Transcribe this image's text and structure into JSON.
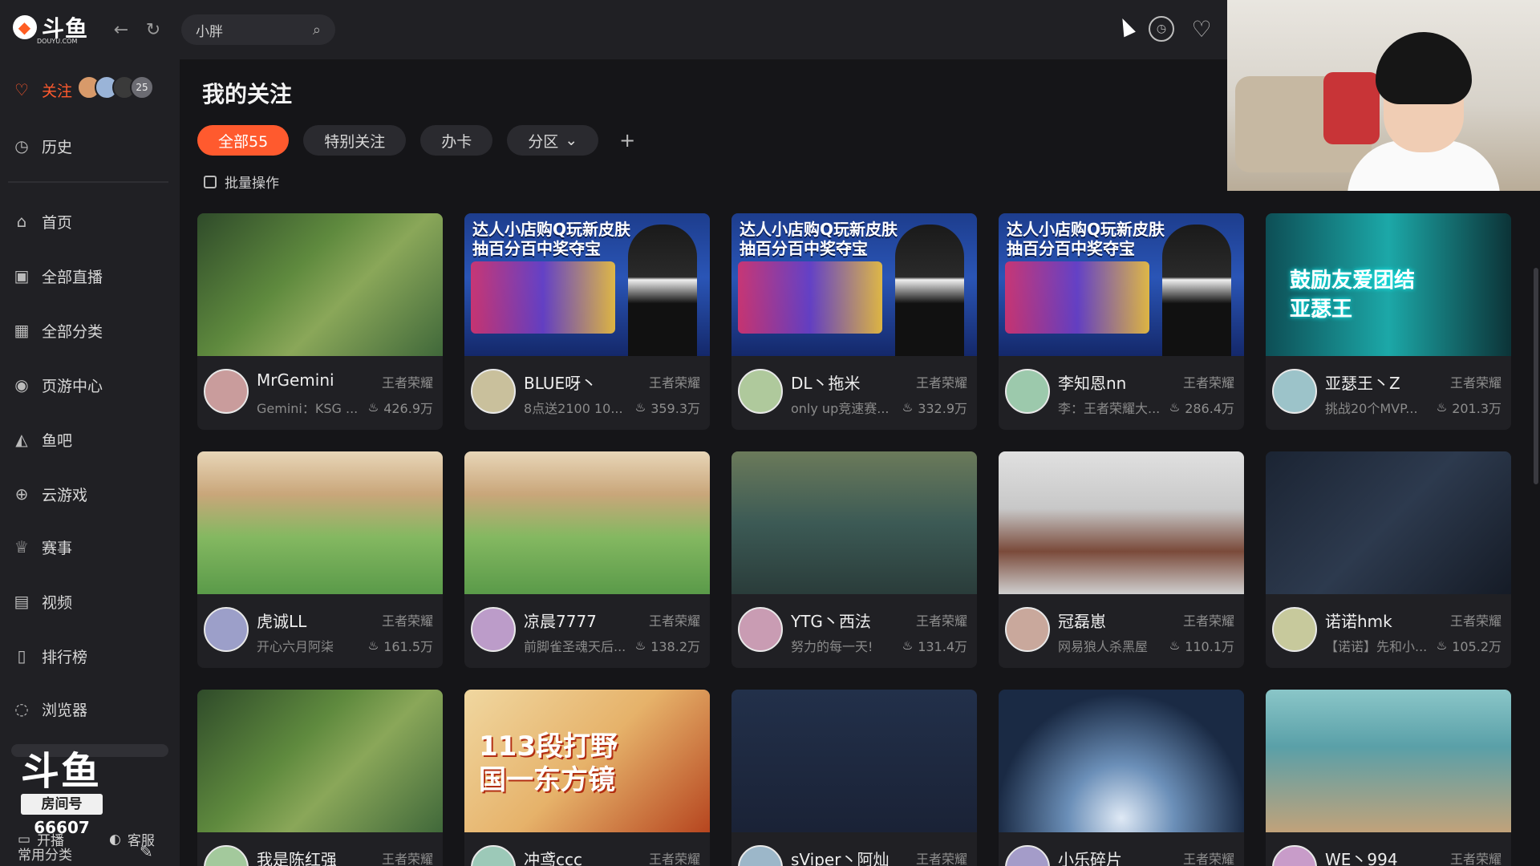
{
  "app": {
    "logo_text": "斗鱼",
    "logo_domain": "DOUYU.COM"
  },
  "search": {
    "value": "小胖"
  },
  "sidebar": {
    "follow": {
      "label": "关注",
      "count": "25"
    },
    "history": {
      "label": "历史"
    },
    "items": [
      {
        "label": "首页",
        "icon": "home-icon"
      },
      {
        "label": "全部直播",
        "icon": "live-icon"
      },
      {
        "label": "全部分类",
        "icon": "grid-icon"
      },
      {
        "label": "页游中心",
        "icon": "game-center-icon"
      },
      {
        "label": "鱼吧",
        "icon": "fishbar-icon"
      },
      {
        "label": "云游戏",
        "icon": "controller-icon"
      },
      {
        "label": "赛事",
        "icon": "trophy-icon"
      },
      {
        "label": "视频",
        "icon": "video-icon"
      },
      {
        "label": "排行榜",
        "icon": "rank-icon"
      },
      {
        "label": "浏览器",
        "icon": "browser-icon"
      }
    ],
    "common_label": "常用分类",
    "room_logo": {
      "big": "斗鱼",
      "tag": "房间号",
      "number": "66607"
    },
    "bottom": {
      "start_live": "开播",
      "service": "客服"
    }
  },
  "main": {
    "title": "我的关注",
    "tabs": [
      {
        "label": "全部55",
        "active": true
      },
      {
        "label": "特别关注",
        "active": false
      },
      {
        "label": "办卡",
        "active": false
      },
      {
        "label": "分区",
        "active": false,
        "dropdown": true
      }
    ],
    "add_tab": "+",
    "batch_label": "批量操作"
  },
  "cards": [
    {
      "name": "MrGemini",
      "category": "王者荣耀",
      "desc": "Gemini：KSG ...",
      "heat": "426.9万",
      "theme": "th-green"
    },
    {
      "name": "BLUE呀丶",
      "category": "王者荣耀",
      "desc": "8点送2100 10...",
      "heat": "359.3万",
      "theme": "th-ad"
    },
    {
      "name": "DL丶拖米",
      "category": "王者荣耀",
      "desc": "only up竞速赛...",
      "heat": "332.9万",
      "theme": "th-ad"
    },
    {
      "name": "李知恩nn",
      "category": "王者荣耀",
      "desc": "李：王者荣耀大...",
      "heat": "286.4万",
      "theme": "th-ad"
    },
    {
      "name": "亚瑟王丶Z",
      "category": "王者荣耀",
      "desc": "挑战20个MVP...",
      "heat": "201.3万",
      "theme": "th-teal"
    },
    {
      "name": "虎诚LL",
      "category": "王者荣耀",
      "desc": "开心六月阿柒",
      "heat": "161.5万",
      "theme": "th-garden"
    },
    {
      "name": "凉晨7777",
      "category": "王者荣耀",
      "desc": "前脚雀圣魂天后...",
      "heat": "138.2万",
      "theme": "th-garden"
    },
    {
      "name": "YTG丶西法",
      "category": "王者荣耀",
      "desc": "努力的每一天!",
      "heat": "131.4万",
      "theme": "th-game"
    },
    {
      "name": "冠磊崽",
      "category": "王者荣耀",
      "desc": "网易狼人杀黑屋",
      "heat": "110.1万",
      "theme": "th-screen"
    },
    {
      "name": "诺诺hmk",
      "category": "王者荣耀",
      "desc": "【诺诺】先和小...",
      "heat": "105.2万",
      "theme": "th-dark"
    },
    {
      "name": "我是陈红强",
      "category": "王者荣耀",
      "desc": "",
      "heat": "",
      "theme": "th-green"
    },
    {
      "name": "冲鸢ccc",
      "category": "王者荣耀",
      "desc": "",
      "heat": "",
      "theme": "th-art"
    },
    {
      "name": "sViper丶阿灿",
      "category": "王者荣耀",
      "desc": "",
      "heat": "",
      "theme": "th-menu"
    },
    {
      "name": "小乐碎片",
      "category": "王者荣耀",
      "desc": "",
      "heat": "",
      "theme": "th-space"
    },
    {
      "name": "WE丶994",
      "category": "王者荣耀",
      "desc": "",
      "heat": "",
      "theme": "th-fps"
    }
  ],
  "thumb_text": {
    "ad_line1": "达人小店购Q玩新皮肤",
    "ad_line2": "抽百分百中奖夺宝",
    "teal_line1": "鼓励友爱团结",
    "teal_line2": "亚瑟王",
    "art_line1": "113段打野",
    "art_line2": "国一东方镜"
  },
  "colors": {
    "accent": "#ff5a2e",
    "bg": "#151518",
    "panel": "#202024"
  }
}
